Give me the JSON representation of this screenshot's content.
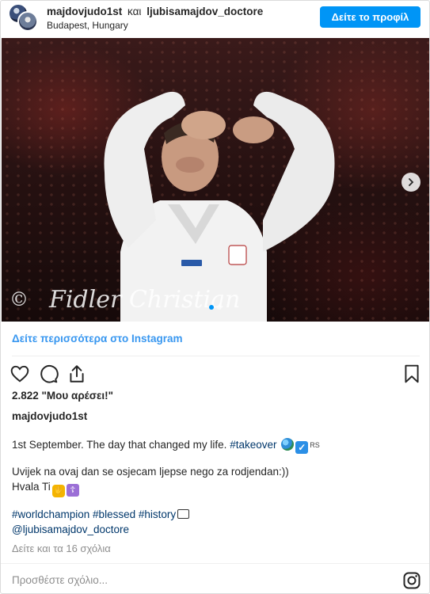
{
  "header": {
    "username": "majdovjudo1st",
    "conjunction": "και",
    "coauthor": "ljubisamajdov_doctore",
    "location": "Budapest, Hungary",
    "view_profile": "Δείτε το προφίλ"
  },
  "post": {
    "see_more": "Δείτε περισσότερα στο Instagram",
    "likes": "2.822 \"Μου αρέσει!\"",
    "owner": "majdovjudo1st",
    "caption": {
      "line1_text": "1st September. The day that changed my life.",
      "line1_tag": "#takeover",
      "line1_rs": "RS",
      "line2": "Uvijek na ovaj dan se osjecam ljepse nego za rodjendan:))",
      "line3": "Hvala Ti",
      "line4_tags": "#worldchampion #blessed #history",
      "line5_mention": "@ljubisamajdov_doctore"
    },
    "view_comments": "Δείτε και τα 16 σχόλια",
    "add_comment_placeholder": "Προσθέστε σχόλιο...",
    "image_watermark": "Fidler Christian",
    "carousel": {
      "count": 2,
      "active": 1
    }
  },
  "colors": {
    "accent": "#0095f6",
    "link": "#3897f0",
    "hashtag": "#00376b"
  },
  "icons": [
    "heart-icon",
    "comment-icon",
    "share-icon",
    "bookmark-icon",
    "chevron-right-icon",
    "instagram-icon"
  ]
}
